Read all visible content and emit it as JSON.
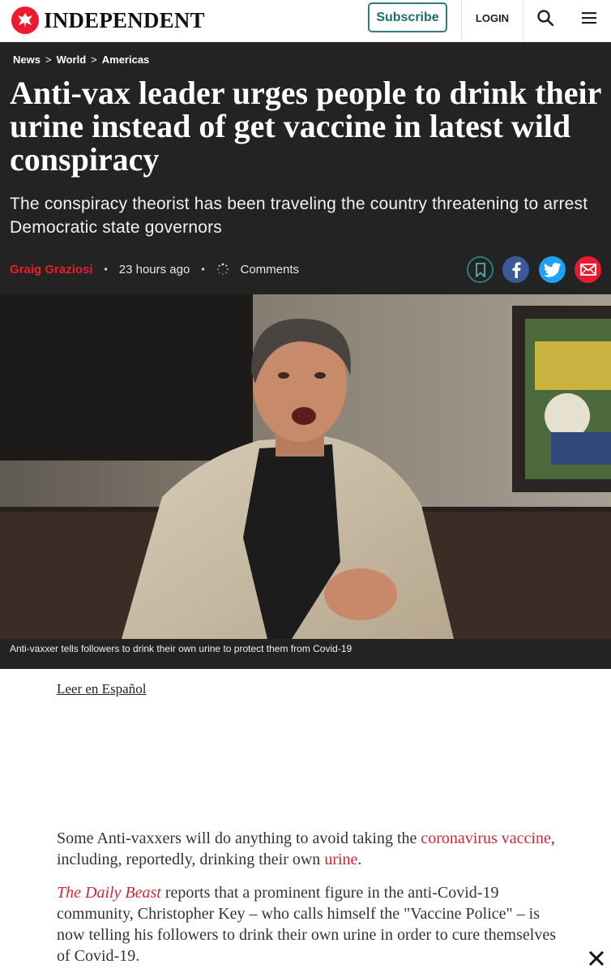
{
  "topbar": {
    "brand": "INDEPENDENT",
    "subscribe_label": "Subscribe",
    "login_label": "LOGIN",
    "icons": {
      "logo": "eagle-logo-icon",
      "search": "search-icon",
      "menu": "hamburger-menu-icon"
    }
  },
  "breadcrumb": [
    "News",
    "World",
    "Americas"
  ],
  "breadcrumb_separator": ">",
  "article": {
    "headline": "Anti-vax leader urges people to drink their urine instead of get vaccine in latest wild conspiracy",
    "standfirst": "The conspiracy theorist has been traveling the country threatening to arrest Democratic state governors",
    "author": "Graig Graziosi",
    "published": "23 hours ago",
    "comments_label": "Comments",
    "caption": "Anti-vaxxer tells followers to drink their own urine to protect them from Covid-19",
    "spanish_link": "Leer en Español",
    "para1": {
      "before": "Some Anti-vaxxers will do anything to avoid taking the ",
      "link1": "coronavirus vaccine",
      "middle": ", including, reportedly, drinking their own ",
      "link2": "urine",
      "after": "."
    },
    "para2": {
      "source": "The Daily Beast",
      "text": " reports that a prominent figure in the anti-Covid-19 community, Christopher Key – who calls himself the \"Vaccine Police\" – is now telling his followers to drink their own urine in order to cure themselves of Covid-19."
    }
  },
  "share": {
    "icons": [
      "bookmark-icon",
      "facebook-icon",
      "twitter-icon",
      "email-icon"
    ]
  },
  "colors": {
    "brand_red": "#ec1a2e",
    "teal": "#2c7d7c",
    "header_bg": "#232323",
    "link_red": "#d0283b",
    "facebook": "#3b5998",
    "twitter": "#1da1f2"
  }
}
